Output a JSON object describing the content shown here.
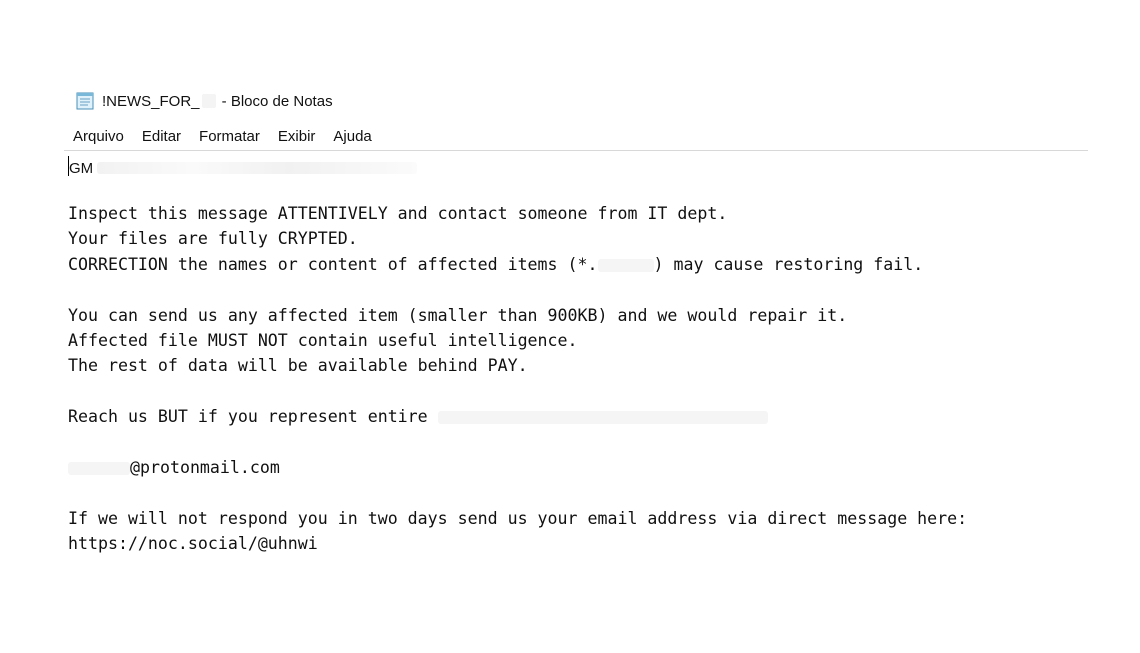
{
  "window": {
    "title_prefix": "!NEWS_FOR_",
    "title_suffix": " - Bloco de Notas",
    "icon": "notepad-icon"
  },
  "menu": {
    "items": [
      "Arquivo",
      "Editar",
      "Formatar",
      "Exibir",
      "Ajuda"
    ]
  },
  "document": {
    "first_line_prefix": "GM",
    "lines": [
      "Inspect this message ATTENTIVELY and contact someone from IT dept.",
      "Your files are fully CRYPTED.",
      "CORRECTION the names or content of affected items (*.",
      ") may cause restoring fail.",
      "You can send us any affected item (smaller than 900KB) and we would repair it.",
      "Affected file MUST NOT contain useful intelligence.",
      "The rest of data will be available behind PAY.",
      "Reach us BUT if you represent entire ",
      "@protonmail.com",
      "If we will not respond you in two days send us your email address via direct message here:",
      "https://noc.social/@uhnwi"
    ]
  }
}
